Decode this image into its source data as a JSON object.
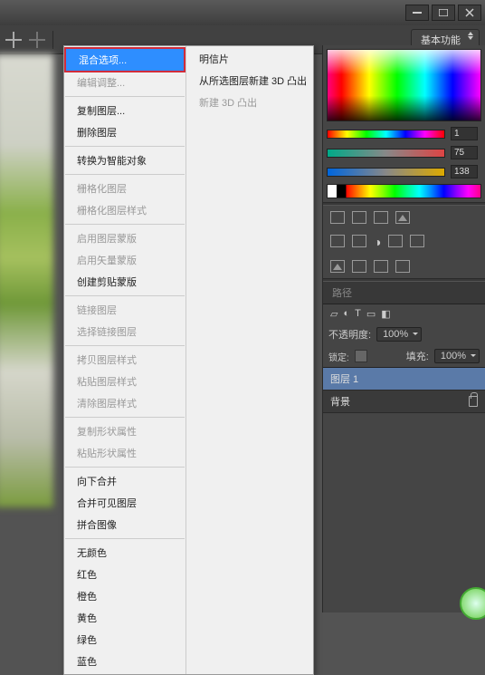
{
  "window": {
    "workspace_label": "基本功能"
  },
  "menu": {
    "col1": [
      {
        "label": "混合选项...",
        "type": "hl"
      },
      {
        "label": "编辑调整...",
        "type": "dis"
      },
      {
        "type": "sep"
      },
      {
        "label": "复制图层...",
        "type": "n"
      },
      {
        "label": "删除图层",
        "type": "n"
      },
      {
        "type": "sep"
      },
      {
        "label": "转换为智能对象",
        "type": "n"
      },
      {
        "type": "sep"
      },
      {
        "label": "栅格化图层",
        "type": "dis"
      },
      {
        "label": "栅格化图层样式",
        "type": "dis"
      },
      {
        "type": "sep"
      },
      {
        "label": "启用图层蒙版",
        "type": "dis"
      },
      {
        "label": "启用矢量蒙版",
        "type": "dis"
      },
      {
        "label": "创建剪贴蒙版",
        "type": "n"
      },
      {
        "type": "sep"
      },
      {
        "label": "链接图层",
        "type": "dis"
      },
      {
        "label": "选择链接图层",
        "type": "dis"
      },
      {
        "type": "sep"
      },
      {
        "label": "拷贝图层样式",
        "type": "dis"
      },
      {
        "label": "粘贴图层样式",
        "type": "dis"
      },
      {
        "label": "清除图层样式",
        "type": "dis"
      },
      {
        "type": "sep"
      },
      {
        "label": "复制形状属性",
        "type": "dis"
      },
      {
        "label": "粘贴形状属性",
        "type": "dis"
      },
      {
        "type": "sep"
      },
      {
        "label": "向下合并",
        "type": "n"
      },
      {
        "label": "合并可见图层",
        "type": "n"
      },
      {
        "label": "拼合图像",
        "type": "n"
      },
      {
        "type": "sep"
      },
      {
        "label": "无颜色",
        "type": "n"
      },
      {
        "label": "红色",
        "type": "n"
      },
      {
        "label": "橙色",
        "type": "n"
      },
      {
        "label": "黄色",
        "type": "n"
      },
      {
        "label": "绿色",
        "type": "n"
      },
      {
        "label": "蓝色",
        "type": "n"
      }
    ],
    "col2": [
      {
        "label": "明信片",
        "type": "n"
      },
      {
        "label": "从所选图层新建 3D 凸出",
        "type": "n"
      },
      {
        "label": "新建 3D 凸出",
        "type": "dis"
      }
    ]
  },
  "color": {
    "lab_l": "1",
    "lab_a": "75",
    "lab_b": "138"
  },
  "layers": {
    "tab_paths": "路径",
    "opacity_label": "不透明度:",
    "opacity_val": "100%",
    "fill_label": "填充:",
    "fill_val": "100%",
    "lock_label": "锁定:",
    "items": [
      {
        "name": "图层 1"
      },
      {
        "name": "背景"
      }
    ]
  }
}
